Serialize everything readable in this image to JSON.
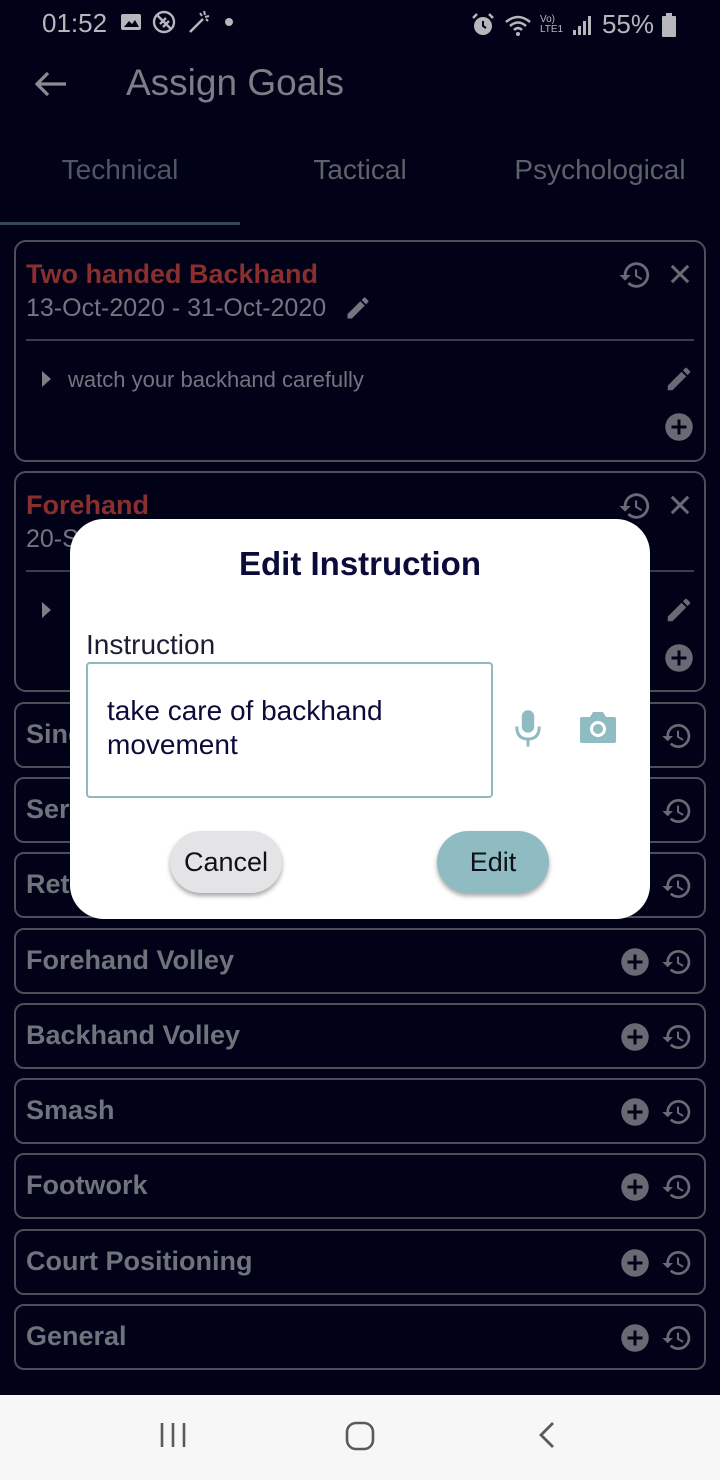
{
  "status_bar": {
    "time": "01:52",
    "battery_percent": "55%",
    "network_label": "Vo) LTE1"
  },
  "app_bar": {
    "title": "Assign Goals",
    "back_icon": "arrow-left-icon"
  },
  "tabs": [
    {
      "label": "Technical",
      "active": true
    },
    {
      "label": "Tactical",
      "active": false
    },
    {
      "label": "Psychological",
      "active": false
    }
  ],
  "goal_cards": [
    {
      "title": "Two handed Backhand",
      "date_range": "13-Oct-2020 - 31-Oct-2020",
      "instruction": "watch your backhand carefully"
    },
    {
      "title": "Forehand",
      "date_range": "20-S"
    }
  ],
  "skill_rows": [
    {
      "label": "Sing"
    },
    {
      "label": "Serv"
    },
    {
      "label": "Retu"
    },
    {
      "label": "Forehand Volley"
    },
    {
      "label": "Backhand Volley"
    },
    {
      "label": "Smash"
    },
    {
      "label": "Footwork"
    },
    {
      "label": "Court Positioning"
    },
    {
      "label": "General"
    }
  ],
  "dialog": {
    "title": "Edit Instruction",
    "field_label": "Instruction",
    "field_value": "take care of backhand movement",
    "cancel_label": "Cancel",
    "edit_label": "Edit"
  },
  "colors": {
    "background": "#010118",
    "accent": "#8fbcc2",
    "goal_title": "#8a2e2e"
  }
}
